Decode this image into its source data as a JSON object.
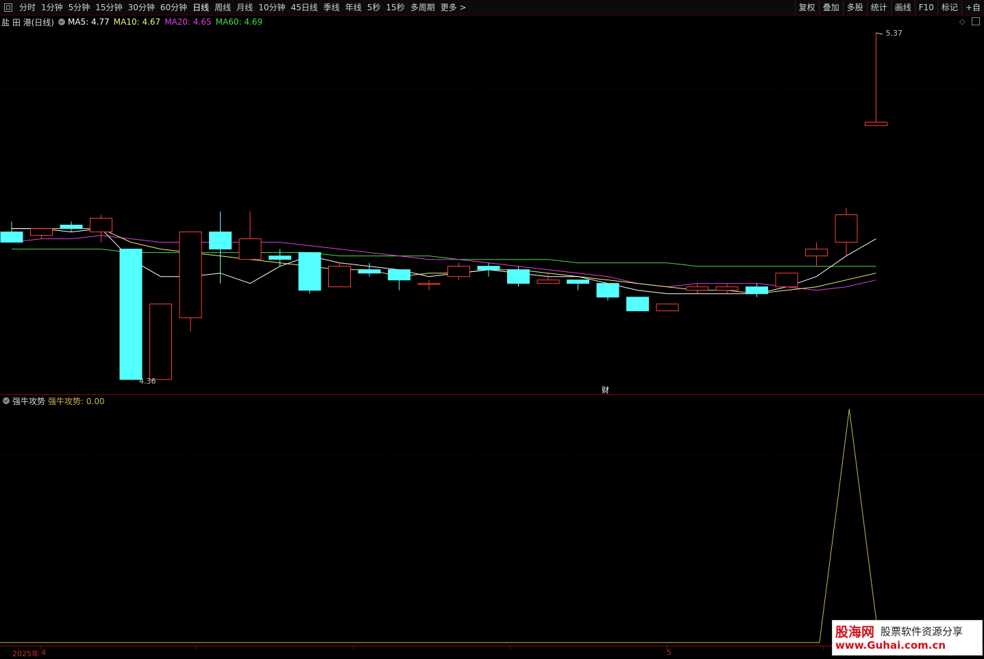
{
  "toolbar": {
    "periods": [
      "分时",
      "1分钟",
      "5分钟",
      "15分钟",
      "30分钟",
      "60分钟",
      "日线",
      "周线",
      "月线",
      "10分钟",
      "45日线",
      "季线",
      "年线",
      "5秒",
      "15秒",
      "多周期",
      "更多 >"
    ],
    "active_period": "日线",
    "tools": [
      "复权",
      "叠加",
      "多股",
      "统计",
      "画线",
      "F10",
      "标记",
      "+自"
    ]
  },
  "main": {
    "stock_label": "盐 田 港(日线)",
    "ma": [
      {
        "label": "MA5: 4.77",
        "color": "#ffffff"
      },
      {
        "label": "MA10: 4.67",
        "color": "#f0f080"
      },
      {
        "label": "MA20: 4.65",
        "color": "#e040e0"
      },
      {
        "label": "MA60: 4.69",
        "color": "#40e040"
      }
    ],
    "high_label": "5.37",
    "low_label": "4.36",
    "finance_marker": "财"
  },
  "sub": {
    "indicator_name": "强牛攻势",
    "indicator_value": "强牛攻势: 0.00"
  },
  "dates": {
    "year_label": "2025年",
    "month_a": "4",
    "month_b": "5"
  },
  "watermark": {
    "brand": "股海网",
    "slogan": "股票软件资源分享",
    "url": "www.Guhai.com.cn"
  },
  "colors": {
    "up": "#ff4040",
    "down": "#54ffff",
    "grid": "#5a0000",
    "ma5": "#ffffff",
    "ma10": "#f0f080",
    "ma20": "#e040e0",
    "ma60": "#40e040",
    "indicator": "#c8b850"
  },
  "chart_data": {
    "type": "candlestick",
    "price_axis": {
      "min": 4.36,
      "max": 5.37
    },
    "candles": [
      {
        "o": 4.79,
        "c": 4.76,
        "h": 4.82,
        "l": 4.76
      },
      {
        "o": 4.78,
        "c": 4.8,
        "h": 4.8,
        "l": 4.77
      },
      {
        "o": 4.81,
        "c": 4.8,
        "h": 4.82,
        "l": 4.79
      },
      {
        "o": 4.79,
        "c": 4.83,
        "h": 4.84,
        "l": 4.76
      },
      {
        "o": 4.74,
        "c": 4.36,
        "h": 4.74,
        "l": 4.36
      },
      {
        "o": 4.36,
        "c": 4.58,
        "h": 4.58,
        "l": 4.36
      },
      {
        "o": 4.54,
        "c": 4.79,
        "h": 4.79,
        "l": 4.5
      },
      {
        "o": 4.79,
        "c": 4.74,
        "h": 4.85,
        "l": 4.64
      },
      {
        "o": 4.71,
        "c": 4.77,
        "h": 4.85,
        "l": 4.71
      },
      {
        "o": 4.72,
        "c": 4.71,
        "h": 4.74,
        "l": 4.69
      },
      {
        "o": 4.73,
        "c": 4.62,
        "h": 4.73,
        "l": 4.61
      },
      {
        "o": 4.63,
        "c": 4.69,
        "h": 4.7,
        "l": 4.63
      },
      {
        "o": 4.68,
        "c": 4.67,
        "h": 4.7,
        "l": 4.66
      },
      {
        "o": 4.68,
        "c": 4.65,
        "h": 4.68,
        "l": 4.62
      },
      {
        "o": 4.64,
        "c": 4.64,
        "h": 4.65,
        "l": 4.62
      },
      {
        "o": 4.66,
        "c": 4.69,
        "h": 4.7,
        "l": 4.65
      },
      {
        "o": 4.69,
        "c": 4.68,
        "h": 4.7,
        "l": 4.66
      },
      {
        "o": 4.68,
        "c": 4.64,
        "h": 4.69,
        "l": 4.63
      },
      {
        "o": 4.64,
        "c": 4.65,
        "h": 4.67,
        "l": 4.64
      },
      {
        "o": 4.65,
        "c": 4.64,
        "h": 4.65,
        "l": 4.62
      },
      {
        "o": 4.64,
        "c": 4.6,
        "h": 4.64,
        "l": 4.59
      },
      {
        "o": 4.6,
        "c": 4.56,
        "h": 4.6,
        "l": 4.56
      },
      {
        "o": 4.56,
        "c": 4.58,
        "h": 4.58,
        "l": 4.56
      },
      {
        "o": 4.62,
        "c": 4.63,
        "h": 4.64,
        "l": 4.61
      },
      {
        "o": 4.62,
        "c": 4.63,
        "h": 4.64,
        "l": 4.61
      },
      {
        "o": 4.63,
        "c": 4.61,
        "h": 4.64,
        "l": 4.6
      },
      {
        "o": 4.63,
        "c": 4.67,
        "h": 4.67,
        "l": 4.63
      },
      {
        "o": 4.72,
        "c": 4.74,
        "h": 4.76,
        "l": 4.69
      },
      {
        "o": 4.76,
        "c": 4.84,
        "h": 4.86,
        "l": 4.72
      },
      {
        "o": 5.1,
        "c": 5.11,
        "h": 5.37,
        "l": 5.1
      }
    ],
    "ma5": [
      4.8,
      4.8,
      4.79,
      4.8,
      4.71,
      4.66,
      4.66,
      4.67,
      4.64,
      4.69,
      4.72,
      4.7,
      4.69,
      4.68,
      4.66,
      4.67,
      4.68,
      4.67,
      4.66,
      4.66,
      4.64,
      4.62,
      4.61,
      4.61,
      4.61,
      4.61,
      4.63,
      4.66,
      4.72,
      4.77
    ],
    "ma10": [
      4.8,
      4.8,
      4.8,
      4.8,
      4.76,
      4.74,
      4.73,
      4.72,
      4.71,
      4.7,
      4.69,
      4.68,
      4.68,
      4.66,
      4.67,
      4.67,
      4.68,
      4.68,
      4.67,
      4.66,
      4.65,
      4.64,
      4.63,
      4.62,
      4.62,
      4.61,
      4.62,
      4.63,
      4.65,
      4.67
    ],
    "ma20": [
      4.76,
      4.77,
      4.77,
      4.78,
      4.77,
      4.76,
      4.76,
      4.76,
      4.76,
      4.76,
      4.75,
      4.74,
      4.73,
      4.72,
      4.71,
      4.71,
      4.7,
      4.69,
      4.68,
      4.67,
      4.66,
      4.64,
      4.63,
      4.64,
      4.64,
      4.64,
      4.63,
      4.62,
      4.63,
      4.65
    ],
    "ma60": [
      4.74,
      4.74,
      4.74,
      4.74,
      4.73,
      4.73,
      4.73,
      4.73,
      4.73,
      4.73,
      4.73,
      4.72,
      4.72,
      4.72,
      4.72,
      4.71,
      4.71,
      4.71,
      4.71,
      4.7,
      4.7,
      4.7,
      4.7,
      4.69,
      4.69,
      4.69,
      4.69,
      4.69,
      4.69,
      4.69
    ],
    "indicator": [
      0,
      0,
      0,
      0,
      0,
      0,
      0,
      0,
      0,
      0,
      0,
      0,
      0,
      0,
      0,
      0,
      0,
      0,
      0,
      0,
      0,
      0,
      0,
      0,
      0,
      0,
      0,
      0,
      1,
      0
    ]
  }
}
